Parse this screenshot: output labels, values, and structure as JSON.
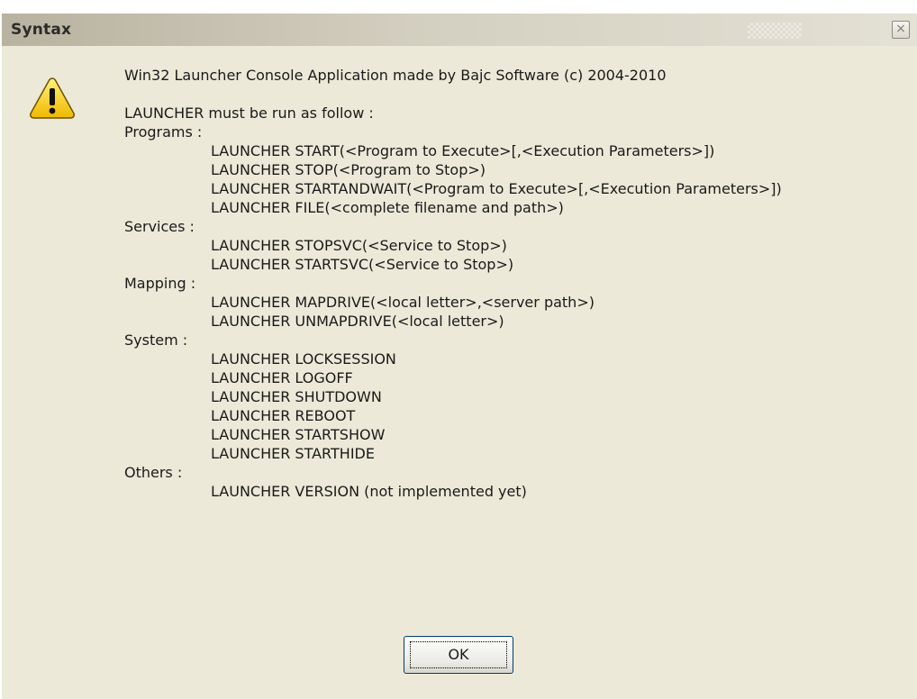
{
  "dialog": {
    "title": "Syntax",
    "close_glyph": "×",
    "icon": "warning-icon",
    "ok_label": "OK"
  },
  "body": {
    "lines": [
      {
        "text": "Win32 Launcher Console Application made by Bajc Software (c) 2004-2010",
        "indent": false
      },
      {
        "text": "",
        "indent": false
      },
      {
        "text": "LAUNCHER must be run as follow :",
        "indent": false
      },
      {
        "text": "Programs :",
        "indent": false
      },
      {
        "text": "LAUNCHER START(<Program to Execute>[,<Execution Parameters>])",
        "indent": true
      },
      {
        "text": "LAUNCHER STOP(<Program to Stop>)",
        "indent": true
      },
      {
        "text": "LAUNCHER STARTANDWAIT(<Program to Execute>[,<Execution Parameters>])",
        "indent": true
      },
      {
        "text": "LAUNCHER FILE(<complete filename and path>)",
        "indent": true
      },
      {
        "text": "Services :",
        "indent": false
      },
      {
        "text": "LAUNCHER STOPSVC(<Service to Stop>)",
        "indent": true
      },
      {
        "text": "LAUNCHER STARTSVC(<Service to Stop>)",
        "indent": true
      },
      {
        "text": "Mapping :",
        "indent": false
      },
      {
        "text": "LAUNCHER MAPDRIVE(<local letter>,<server path>)",
        "indent": true
      },
      {
        "text": "LAUNCHER UNMAPDRIVE(<local letter>)",
        "indent": true
      },
      {
        "text": "System :",
        "indent": false
      },
      {
        "text": "LAUNCHER LOCKSESSION",
        "indent": true
      },
      {
        "text": "LAUNCHER LOGOFF",
        "indent": true
      },
      {
        "text": "LAUNCHER SHUTDOWN",
        "indent": true
      },
      {
        "text": "LAUNCHER REBOOT",
        "indent": true
      },
      {
        "text": "LAUNCHER STARTSHOW",
        "indent": true
      },
      {
        "text": "LAUNCHER STARTHIDE",
        "indent": true
      },
      {
        "text": "Others :",
        "indent": false
      },
      {
        "text": "LAUNCHER VERSION (not implemented yet)",
        "indent": true
      }
    ]
  },
  "colors": {
    "background": "#ece9d8",
    "icon_yellow": "#f5c400",
    "button_border": "#003c74"
  }
}
